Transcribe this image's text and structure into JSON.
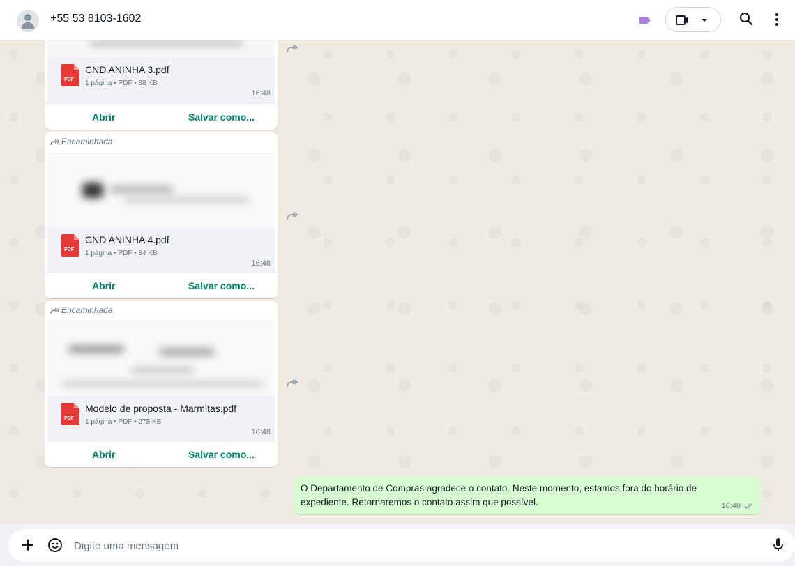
{
  "header": {
    "contact_name": "+55 53 8103-1602",
    "icons": [
      "avatar-icon",
      "label-icon",
      "video-call-icon",
      "chevron-down-icon",
      "search-icon",
      "more-vert-icon"
    ]
  },
  "messages": [
    {
      "forwarded_label": "",
      "file_name": "CND ANINHA 3.pdf",
      "file_meta": "1 página • PDF • 88 KB",
      "time": "16:48",
      "open_label": "Abrir",
      "save_label": "Salvar como..."
    },
    {
      "forwarded_label": "Encaminhada",
      "file_name": "CND ANINHA 4.pdf",
      "file_meta": "1 página • PDF • 84 KB",
      "time": "16:48",
      "open_label": "Abrir",
      "save_label": "Salvar como..."
    },
    {
      "forwarded_label": "Encaminhada",
      "file_name": "Modelo de proposta - Marmitas.pdf",
      "file_meta": "1 página • PDF • 275 KB",
      "time": "16:48",
      "open_label": "Abrir",
      "save_label": "Salvar como..."
    }
  ],
  "outgoing": {
    "text": "O Departamento de Compras agradece o contato. Neste momento, estamos fora do horário de expediente. Retornaremos o contato assim que possível.",
    "time": "16:48",
    "status": "read-double-check"
  },
  "composer": {
    "placeholder": "Digite uma mensagem"
  },
  "colors": {
    "accent": "#008069",
    "outgoing_bubble": "#d9fdd3",
    "chat_background": "#efeae2",
    "label": "#a77fe0",
    "pdf_red": "#e53935"
  }
}
